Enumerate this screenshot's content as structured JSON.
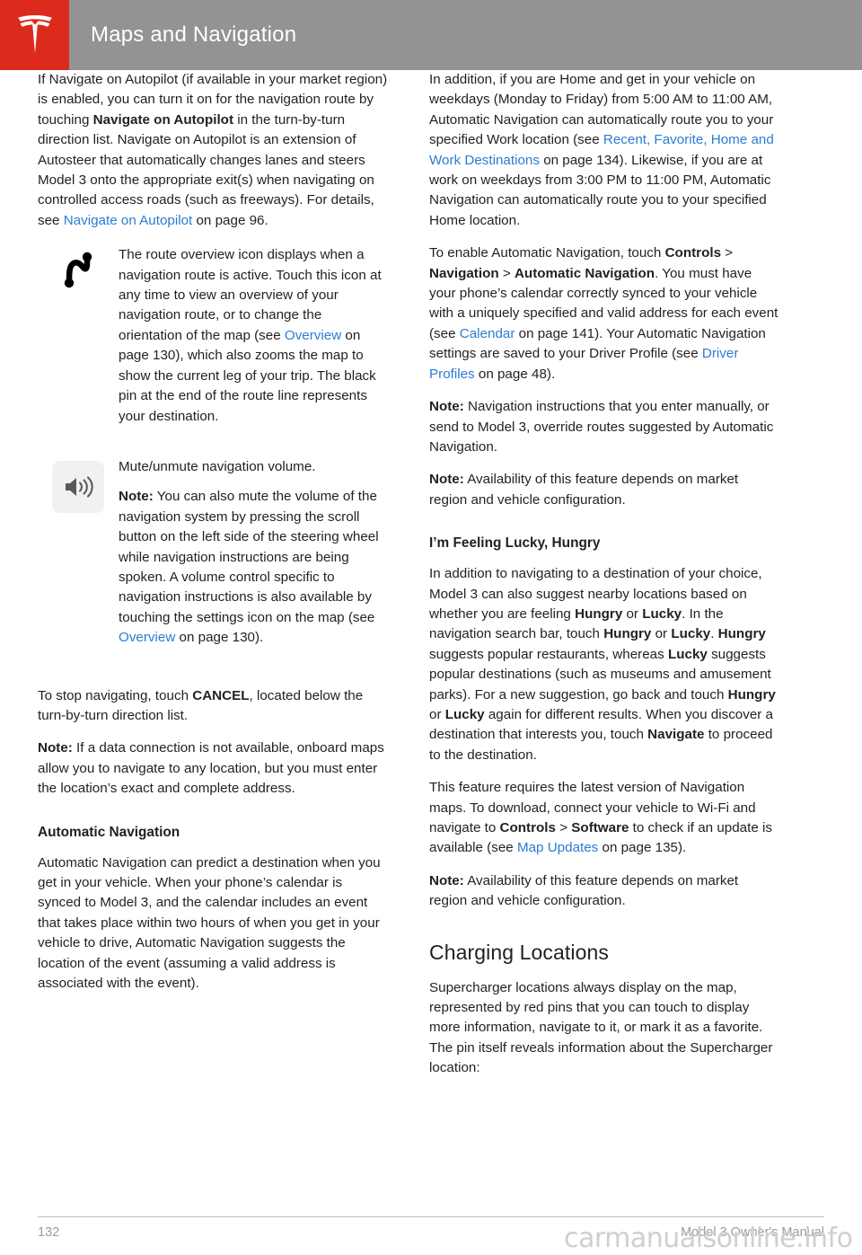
{
  "header": {
    "title": "Maps and Navigation",
    "logo": "tesla-logo",
    "bar_color": "#939393",
    "logo_block_color": "#dc2b1c"
  },
  "colors": {
    "link": "#2b7cd3",
    "text": "#231f20",
    "footer_text": "#9b9b9b",
    "watermark": "#cfcfcf",
    "icon_tile": "#f1f1f1"
  },
  "left_column": {
    "para_navigate_autopilot": {
      "s1": "If Navigate on Autopilot (if available in your market region) is enabled, you can turn it on for the navigation route by touching ",
      "b1": "Navigate on Autopilot",
      "s2": " in the turn-by-turn direction list. Navigate on Autopilot is an extension of Autosteer that automatically changes lanes and steers Model 3 onto the appropriate exit(s) when navigating on controlled access roads (such as freeways). For details, see ",
      "link1": "Navigate on Autopilot",
      "s3": " on page 96."
    },
    "route_overview_row": {
      "icon": "route-overview-icon",
      "s1": "The route overview icon displays when a navigation route is active. Touch this icon at any time to view an overview of your navigation route, or to change the orientation of the map (see ",
      "link1": "Overview",
      "s2": " on page 130), which also zooms the map to show the current leg of your trip. The black pin at the end of the route line represents your destination."
    },
    "volume_row": {
      "icon": "speaker-volume-icon",
      "line1": "Mute/unmute navigation volume.",
      "note_label": "Note:",
      "note_s1": " You can also mute the volume of the navigation system by pressing the scroll button on the left side of the steering wheel while navigation instructions are being spoken. A volume control specific to navigation instructions is also available by touching the settings icon on the map (see ",
      "note_link": "Overview",
      "note_s2": " on page 130)."
    },
    "para_cancel": {
      "s1": "To stop navigating, touch ",
      "b1": "CANCEL",
      "s2": ", located below the turn-by-turn direction list."
    },
    "note_offline": {
      "label": "Note:",
      "text": " If a data connection is not available, onboard maps allow you to navigate to any location, but you must enter the location’s exact and complete address."
    },
    "heading_automatic_navigation": "Automatic Navigation",
    "para_automatic_navigation": "Automatic Navigation can predict a destination when you get in your vehicle. When your phone’s calendar is synced to Model 3, and the calendar includes an event that takes place within two hours of when you get in your vehicle to drive, Automatic Navigation suggests the location of the event (assuming a valid address is associated with the event)."
  },
  "right_column": {
    "para_home_work": {
      "s1": "In addition, if you are Home and get in your vehicle on weekdays (Monday to Friday) from 5:00 AM to 11:00 AM, Automatic Navigation can automatically route you to your specified Work location (see ",
      "link1": "Recent, Favorite, Home and Work Destinations",
      "s2": " on page 134). Likewise, if you are at work on weekdays from 3:00 PM to 11:00 PM, Automatic Navigation can automatically route you to your specified Home location."
    },
    "para_enable": {
      "s1": "To enable Automatic Navigation, touch ",
      "b1": "Controls",
      "s2": " > ",
      "b2": "Navigation",
      "s3": " > ",
      "b3": "Automatic Navigation",
      "s4": ". You must have your phone’s calendar correctly synced to your vehicle with a uniquely specified and valid address for each event (see ",
      "link1": "Calendar",
      "s5": " on page 141). Your Automatic Navigation settings are saved to your Driver Profile (see ",
      "link2": "Driver Profiles",
      "s6": " on page 48)."
    },
    "note_manual_override": {
      "label": "Note:",
      "text": " Navigation instructions that you enter manually, or send to Model 3, override routes suggested by Automatic Navigation."
    },
    "note_availability_1": {
      "label": "Note:",
      "text": " Availability of this feature depends on market region and vehicle configuration."
    },
    "heading_lucky_hungry": "I’m Feeling Lucky, Hungry",
    "para_lucky_hungry": {
      "s1": "In addition to navigating to a destination of your choice, Model 3 can also suggest nearby locations based on whether you are feeling ",
      "b1": "Hungry",
      "s2": " or ",
      "b2": "Lucky",
      "s3": ". In the navigation search bar, touch ",
      "b3": "Hungry",
      "s4": " or ",
      "b4": "Lucky",
      "s5": ". ",
      "b5": "Hungry",
      "s6": " suggests popular restaurants, whereas ",
      "b6": "Lucky",
      "s7": " suggests popular destinations (such as museums and amusement parks). For a new suggestion, go back and touch ",
      "b7": "Hungry",
      "s8": " or ",
      "b8": "Lucky",
      "s9": " again for different results. When you discover a destination that interests you, touch ",
      "b9": "Navigate",
      "s10": " to proceed to the destination."
    },
    "para_map_updates": {
      "s1": "This feature requires the latest version of Navigation maps. To download, connect your vehicle to Wi-Fi and navigate to ",
      "b1": "Controls",
      "s2": " > ",
      "b2": "Software",
      "s3": " to check if an update is available (see ",
      "link1": "Map Updates",
      "s4": " on page 135)."
    },
    "note_availability_2": {
      "label": "Note:",
      "text": " Availability of this feature depends on market region and vehicle configuration."
    },
    "heading_charging_locations": "Charging Locations",
    "para_charging_locations": "Supercharger locations always display on the map, represented by red pins that you can touch to display more information, navigate to it, or mark it as a favorite. The pin itself reveals information about the Supercharger location:"
  },
  "footer": {
    "page_number": "132",
    "manual_title": "Model 3 Owner's Manual",
    "watermark": "carmanualsonline.info"
  }
}
